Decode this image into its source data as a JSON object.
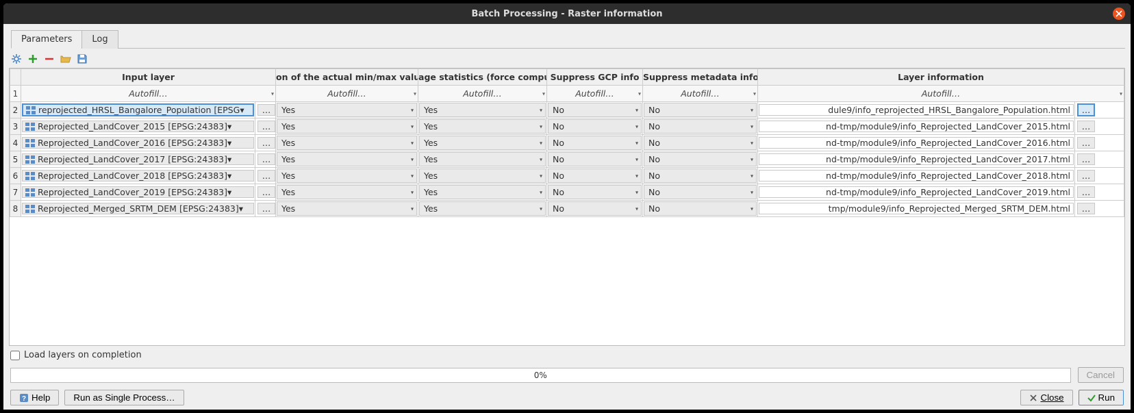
{
  "window": {
    "title": "Batch Processing - Raster information"
  },
  "tabs": {
    "parameters": "Parameters",
    "log": "Log"
  },
  "headers": {
    "input": "Input layer",
    "minmax": "on of the actual min/max valu",
    "stats": "age statistics (force compu",
    "gcp": "Suppress GCP info",
    "meta": "Suppress metadata info",
    "output": "Layer information"
  },
  "autofill_label": "Autofill…",
  "rows": [
    {
      "n": "2",
      "layer": "reprojected_HRSL_Bangalore_Population [EPSG",
      "minmax": "Yes",
      "stats": "Yes",
      "gcp": "No",
      "meta": "No",
      "out": "dule9/info_reprojected_HRSL_Bangalore_Population.html",
      "sel": true
    },
    {
      "n": "3",
      "layer": "Reprojected_LandCover_2015 [EPSG:24383]",
      "minmax": "Yes",
      "stats": "Yes",
      "gcp": "No",
      "meta": "No",
      "out": "nd-tmp/module9/info_Reprojected_LandCover_2015.html",
      "sel": false
    },
    {
      "n": "4",
      "layer": "Reprojected_LandCover_2016 [EPSG:24383]",
      "minmax": "Yes",
      "stats": "Yes",
      "gcp": "No",
      "meta": "No",
      "out": "nd-tmp/module9/info_Reprojected_LandCover_2016.html",
      "sel": false
    },
    {
      "n": "5",
      "layer": "Reprojected_LandCover_2017 [EPSG:24383]",
      "minmax": "Yes",
      "stats": "Yes",
      "gcp": "No",
      "meta": "No",
      "out": "nd-tmp/module9/info_Reprojected_LandCover_2017.html",
      "sel": false
    },
    {
      "n": "6",
      "layer": "Reprojected_LandCover_2018 [EPSG:24383]",
      "minmax": "Yes",
      "stats": "Yes",
      "gcp": "No",
      "meta": "No",
      "out": "nd-tmp/module9/info_Reprojected_LandCover_2018.html",
      "sel": false
    },
    {
      "n": "7",
      "layer": "Reprojected_LandCover_2019 [EPSG:24383]",
      "minmax": "Yes",
      "stats": "Yes",
      "gcp": "No",
      "meta": "No",
      "out": "nd-tmp/module9/info_Reprojected_LandCover_2019.html",
      "sel": false
    },
    {
      "n": "8",
      "layer": "Reprojected_Merged_SRTM_DEM [EPSG:24383]",
      "minmax": "Yes",
      "stats": "Yes",
      "gcp": "No",
      "meta": "No",
      "out": "tmp/module9/info_Reprojected_Merged_SRTM_DEM.html",
      "sel": false
    }
  ],
  "checkbox_label": "Load layers on completion",
  "progress_text": "0%",
  "buttons": {
    "help": "Help",
    "single": "Run as Single Process…",
    "cancel": "Cancel",
    "close": "Close",
    "run": "Run"
  },
  "ellipsis": "…"
}
